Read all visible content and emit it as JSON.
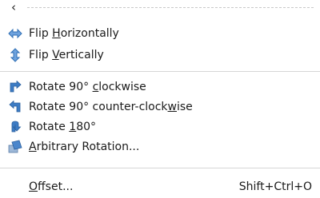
{
  "menu": {
    "back_glyph": "‹",
    "items": [
      {
        "name": "flip-horizontally",
        "pre": "Flip ",
        "ul": "H",
        "post": "orizontally",
        "icon": "flip-horizontal-icon"
      },
      {
        "name": "flip-vertically",
        "pre": "Flip ",
        "ul": "V",
        "post": "ertically",
        "icon": "flip-vertical-icon"
      },
      {
        "name": "rotate-90-clockwise",
        "pre": "Rotate 90° ",
        "ul": "c",
        "post": "lockwise",
        "icon": "rotate-clockwise-icon"
      },
      {
        "name": "rotate-90-counter-clockwise",
        "pre": "Rotate 90° counter-clock",
        "ul": "w",
        "post": "ise",
        "icon": "rotate-counter-clockwise-icon"
      },
      {
        "name": "rotate-180",
        "pre": "Rotate ",
        "ul": "1",
        "post": "80°",
        "icon": "rotate-180-icon"
      },
      {
        "name": "arbitrary-rotation",
        "pre": "",
        "ul": "A",
        "post": "rbitrary Rotation...",
        "icon": "arbitrary-rotation-icon"
      },
      {
        "name": "offset",
        "pre": "",
        "ul": "O",
        "post": "ffset...",
        "shortcut": "Shift+Ctrl+O"
      }
    ]
  },
  "colors": {
    "icon_blue": "#2f6fb5",
    "icon_blue_light": "#6fa3de",
    "separator": "#d6d6d6"
  }
}
